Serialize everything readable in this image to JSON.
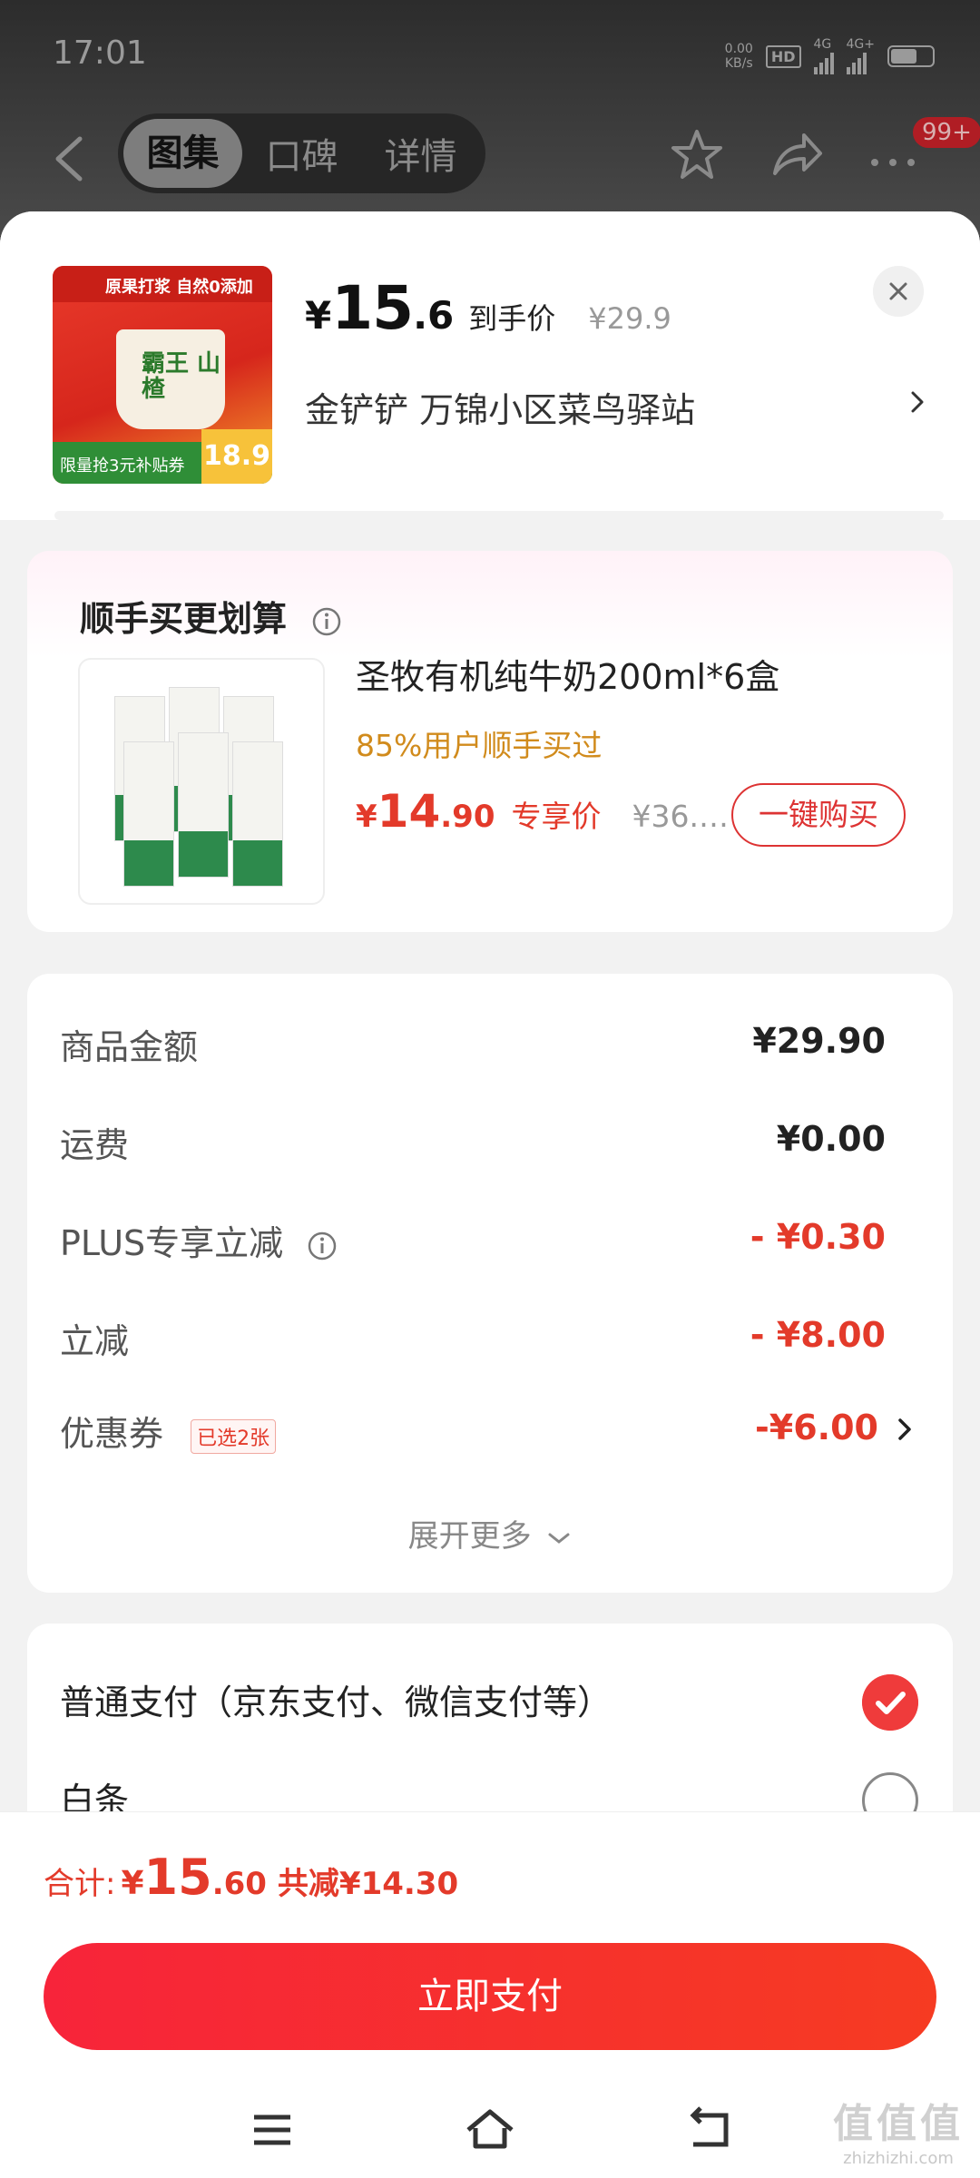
{
  "status_bar": {
    "time": "17:01",
    "net_speed_top": "0.00",
    "net_speed_bottom": "KB/s",
    "hd": "HD",
    "net1": "4G",
    "net2": "4G+"
  },
  "top_nav": {
    "tabs": [
      {
        "label": "图集",
        "active": true
      },
      {
        "label": "口碑",
        "active": false
      },
      {
        "label": "详情",
        "active": false
      }
    ],
    "badge": "99+"
  },
  "product": {
    "thumb_banner": "原果打浆 自然0添加",
    "thumb_cup_text": "霸王 山楂",
    "thumb_bottom_text": "限量抢3元补贴券",
    "thumb_price": "18.9",
    "currency": "¥",
    "price_int": "15",
    "price_dec": ".6",
    "price_tag": "到手价",
    "orig_price": "¥29.9",
    "store": "金铲铲  万锦小区菜鸟驿站"
  },
  "bundle": {
    "title": "顺手买更划算",
    "name": "圣牧有机纯牛奶200ml*6盒",
    "sub": "85%用户顺手买过",
    "currency": "¥",
    "price_int": "14",
    "price_dec": ".90",
    "price_tag": "专享价",
    "orig_price": "¥36.…",
    "buy_label": "一键购买"
  },
  "summary": {
    "rows": [
      {
        "label": "商品金额",
        "value": "¥29.90"
      },
      {
        "label": "运费",
        "value": "¥0.00"
      },
      {
        "label": "PLUS专享立减",
        "value": "- ¥0.30"
      },
      {
        "label": "立减",
        "value": "- ¥8.00"
      },
      {
        "label": "优惠券",
        "value": "-¥6.00",
        "chip": "已选2张"
      }
    ],
    "expand_label": "展开更多"
  },
  "payment": {
    "options": [
      {
        "label": "普通支付（京东支付、微信支付等）",
        "selected": true
      },
      {
        "label": "白条",
        "selected": false
      }
    ]
  },
  "footer": {
    "total_label": "合计:",
    "currency": "¥",
    "total_int": "15",
    "total_dec": ".60",
    "save_text": "共减¥14.30",
    "pay_button": "立即支付"
  },
  "watermark": {
    "logo": "值值值",
    "site": "zhizhizhi.com"
  },
  "colors": {
    "accent_red": "#e33a2a",
    "pay_button": "#f7243a",
    "bundle_sub": "#d18b1c"
  }
}
